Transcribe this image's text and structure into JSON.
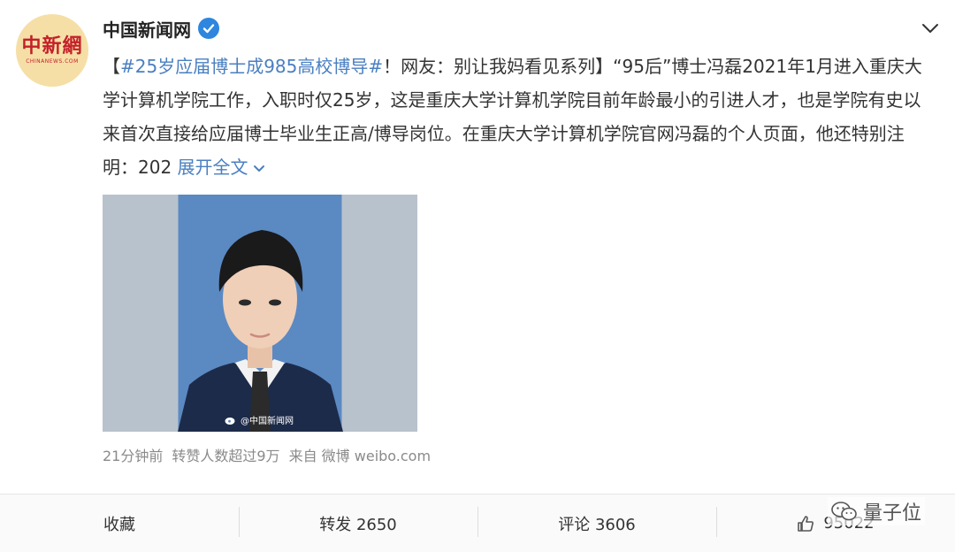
{
  "account": {
    "name": "中国新闻网",
    "avatar_logo": "中新網",
    "avatar_sub": "CHINANEWS.COM"
  },
  "post": {
    "bracket_open": "【",
    "topic": "#25岁应届博士成985高校博导#",
    "headline_rest": "！网友：别让我妈看见系列】",
    "body": "“95后”博士冯磊2021年1月进入重庆大学计算机学院工作，入职时仅25岁，这是重庆大学计算机学院目前年龄最小的引进人才，也是学院有史以来首次直接给应届博士毕业生正高/博导岗位。在重庆大学计算机学院官网冯磊的个人页面，他还特别注明：202",
    "expand_label": "展开全文",
    "image_watermark": "@中国新闻网"
  },
  "meta": {
    "time": "21分钟前",
    "forwards_note": "转赞人数超过9万",
    "source_prefix": "来自",
    "source": "微博 weibo.com"
  },
  "actions": {
    "favorite_label": "收藏",
    "repost_label": "转发 2650",
    "comment_label": "评论 3606",
    "like_label": "95022"
  },
  "brand": {
    "name": "量子位"
  },
  "colors": {
    "link": "#4a7fc1",
    "verified": "#2e86de",
    "photo_bg": "#5b89c2"
  }
}
